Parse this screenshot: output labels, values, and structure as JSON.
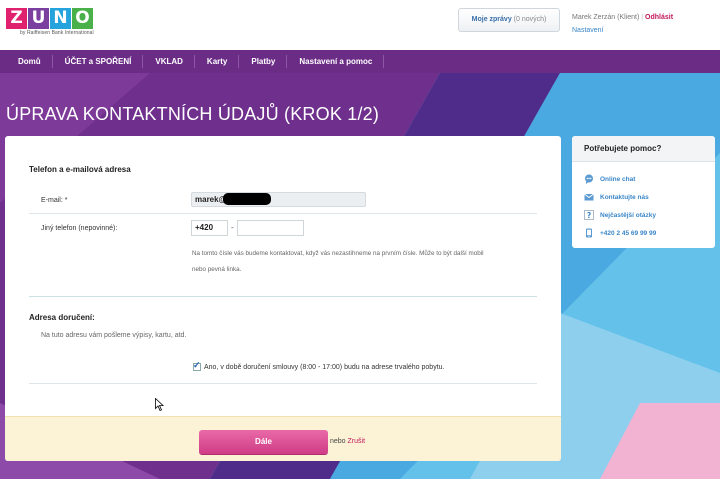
{
  "header": {
    "logo": {
      "letters": [
        "Z",
        "U",
        "N",
        "O"
      ],
      "letter_colors": [
        "#e0226e",
        "#7b3fa0",
        "#25a3dd",
        "#4ab04a"
      ],
      "tagline": "by Raiffeisen Bank International"
    },
    "messages_button": {
      "label": "Moje zprávy",
      "count": "(0 nových)"
    },
    "user": {
      "name": "Marek Zerzán (Klient)",
      "separator": "|",
      "logout": "Odhlásit",
      "settings": "Nastavení"
    }
  },
  "nav": {
    "items": [
      "Domů",
      "ÚČET a SPOŘENÍ",
      "VKLAD",
      "Karty",
      "Platby",
      "Nastavení a pomoc"
    ]
  },
  "page": {
    "title": "ÚPRAVA KONTAKTNÍCH ÚDAJŮ (KROK 1/2)"
  },
  "form": {
    "section_contact": "Telefon a e-mailová adresa",
    "email_label": "E-mail: *",
    "email_value": "marek@",
    "phone_label": "Jiný telefon (nepovinné):",
    "phone_prefix": "+420",
    "phone_dash": "-",
    "phone_value": "",
    "hint_line1": "Na tomto čísle vás budeme kontaktovat, když vás nezastihneme na prvním čísle. Může to být další mobil",
    "hint_line2": "nebo pevná linka.",
    "section_address": "Adresa doručení:",
    "address_intro": "Na tuto adresu vám pošleme výpisy, kartu, atd.",
    "checkbox_checked": true,
    "checkbox_label": "Ano, v době doručení smlouvy (8:00 - 17:00) budu na adrese trvalého pobytu.",
    "next_button": "Dále",
    "or_text": "nebo",
    "cancel_link": "Zrušit"
  },
  "help": {
    "title": "Potřebujete pomoc?",
    "items": [
      {
        "icon": "chat-icon",
        "label": "Online chat"
      },
      {
        "icon": "envelope-icon",
        "label": "Kontaktujte nás"
      },
      {
        "icon": "question-icon",
        "label": "Nejčastější otázky"
      },
      {
        "icon": "phone-icon",
        "label": "+420 2 45 69 99 99"
      }
    ]
  },
  "colors": {
    "nav_purple": "#6b2c86",
    "accent_pink": "#d94590",
    "sky_blue": "#5bb9e6",
    "link_blue": "#3a86c8"
  }
}
